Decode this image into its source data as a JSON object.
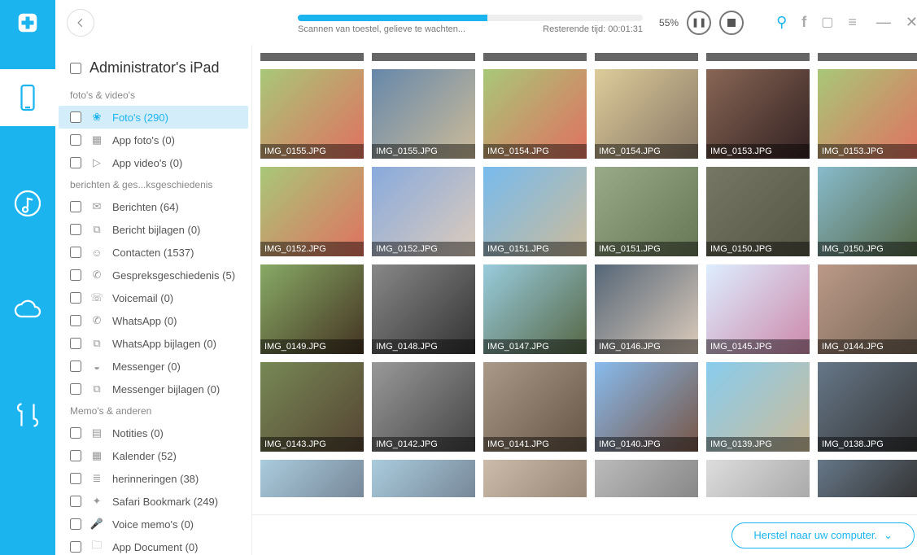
{
  "progress": {
    "percent": 55,
    "percent_text": "55%",
    "status": "Scannen van toestel, gelieve te wachten...",
    "remaining": "Resterende tijd: 00:01:31"
  },
  "device_title": "Administrator's iPad",
  "groups": [
    {
      "label": "foto's & video's",
      "items": [
        {
          "label": "Foto's (290)",
          "icon": "photos",
          "active": true
        },
        {
          "label": "App foto's (0)",
          "icon": "app-photos"
        },
        {
          "label": "App video's (0)",
          "icon": "app-videos"
        }
      ]
    },
    {
      "label": "berichten & ges...ksgeschiedenis",
      "items": [
        {
          "label": "Berichten (64)",
          "icon": "messages"
        },
        {
          "label": "Bericht bijlagen (0)",
          "icon": "msg-attach"
        },
        {
          "label": "Contacten (1537)",
          "icon": "contacts"
        },
        {
          "label": "Gespreksgeschiedenis (5)",
          "icon": "calls"
        },
        {
          "label": "Voicemail (0)",
          "icon": "voicemail"
        },
        {
          "label": "WhatsApp (0)",
          "icon": "whatsapp"
        },
        {
          "label": "WhatsApp bijlagen (0)",
          "icon": "wa-attach"
        },
        {
          "label": "Messenger (0)",
          "icon": "messenger"
        },
        {
          "label": "Messenger bijlagen (0)",
          "icon": "msgr-attach"
        }
      ]
    },
    {
      "label": "Memo's & anderen",
      "items": [
        {
          "label": "Notities (0)",
          "icon": "notes"
        },
        {
          "label": "Kalender (52)",
          "icon": "calendar"
        },
        {
          "label": "herinneringen (38)",
          "icon": "reminders"
        },
        {
          "label": "Safari Bookmark (249)",
          "icon": "safari"
        },
        {
          "label": "Voice memo's (0)",
          "icon": "voice"
        },
        {
          "label": "App Document (0)",
          "icon": "doc"
        }
      ]
    }
  ],
  "thumbs": [
    {
      "name": "IMG_0155.JPG",
      "c1": "#a8c878",
      "c2": "#e07060"
    },
    {
      "name": "IMG_0155.JPG",
      "c1": "#6688aa",
      "c2": "#ccbb99"
    },
    {
      "name": "IMG_0154.JPG",
      "c1": "#a8c878",
      "c2": "#e07060"
    },
    {
      "name": "IMG_0154.JPG",
      "c1": "#ddcc99",
      "c2": "#887766"
    },
    {
      "name": "IMG_0153.JPG",
      "c1": "#886655",
      "c2": "#332222"
    },
    {
      "name": "IMG_0153.JPG",
      "c1": "#a8c878",
      "c2": "#e07060"
    },
    {
      "name": "IMG_0152.JPG",
      "c1": "#a8c878",
      "c2": "#e07060"
    },
    {
      "name": "IMG_0152.JPG",
      "c1": "#88aadd",
      "c2": "#ddccbb"
    },
    {
      "name": "IMG_0151.JPG",
      "c1": "#77bbee",
      "c2": "#ccbb99"
    },
    {
      "name": "IMG_0151.JPG",
      "c1": "#99aa88",
      "c2": "#667755"
    },
    {
      "name": "IMG_0150.JPG",
      "c1": "#777766",
      "c2": "#555544"
    },
    {
      "name": "IMG_0150.JPG",
      "c1": "#88bbcc",
      "c2": "#556644"
    },
    {
      "name": "IMG_0149.JPG",
      "c1": "#88aa66",
      "c2": "#443322"
    },
    {
      "name": "IMG_0148.JPG",
      "c1": "#888888",
      "c2": "#333333"
    },
    {
      "name": "IMG_0147.JPG",
      "c1": "#99ccdd",
      "c2": "#556644"
    },
    {
      "name": "IMG_0146.JPG",
      "c1": "#556677",
      "c2": "#ddccbb"
    },
    {
      "name": "IMG_0145.JPG",
      "c1": "#ddeeff",
      "c2": "#cc88aa"
    },
    {
      "name": "IMG_0144.JPG",
      "c1": "#bb9988",
      "c2": "#776655"
    },
    {
      "name": "IMG_0143.JPG",
      "c1": "#778855",
      "c2": "#554433"
    },
    {
      "name": "IMG_0142.JPG",
      "c1": "#999999",
      "c2": "#444444"
    },
    {
      "name": "IMG_0141.JPG",
      "c1": "#aa9988",
      "c2": "#665544"
    },
    {
      "name": "IMG_0140.JPG",
      "c1": "#88bbee",
      "c2": "#775544"
    },
    {
      "name": "IMG_0139.JPG",
      "c1": "#88ccee",
      "c2": "#ccbb99"
    },
    {
      "name": "IMG_0138.JPG",
      "c1": "#667788",
      "c2": "#333333"
    }
  ],
  "thumbs_partial": [
    {
      "c1": "#aaccdd",
      "c2": "#778899"
    },
    {
      "c1": "#aaccdd",
      "c2": "#778899"
    },
    {
      "c1": "#ccbbaa",
      "c2": "#998877"
    },
    {
      "c1": "#bbbbbb",
      "c2": "#888888"
    },
    {
      "c1": "#dddddd",
      "c2": "#aaaaaa"
    },
    {
      "c1": "#667788",
      "c2": "#333333"
    }
  ],
  "footer_button": "Herstel naar uw computer."
}
